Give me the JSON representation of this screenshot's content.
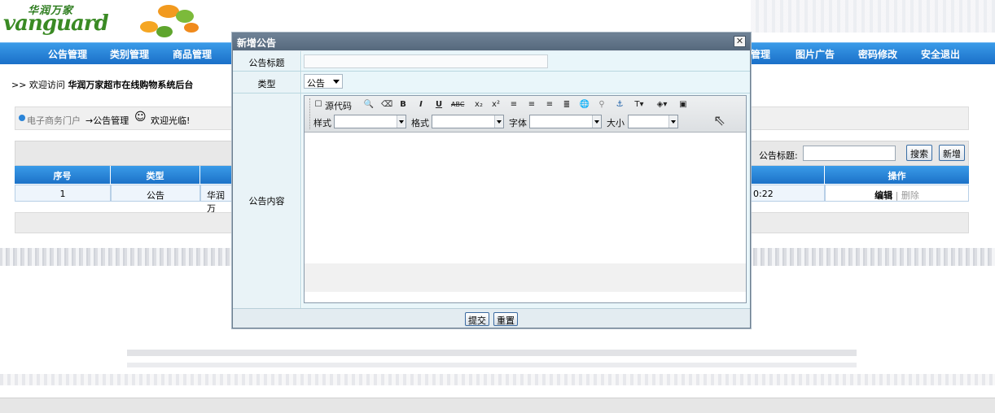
{
  "brand": {
    "cn": "华润万家",
    "en": "vanguard"
  },
  "nav": [
    "公告管理",
    "类别管理",
    "商品管理",
    "管理",
    "图片广告",
    "密码修改",
    "安全退出"
  ],
  "welcome": {
    "prefix": ">> 欢迎访问 ",
    "site": "华润万家超市在线购物系统后台"
  },
  "breadcrumb": {
    "portal": "电子商务门户",
    "current": "→公告管理",
    "greeting": "欢迎光临!"
  },
  "search": {
    "label": "公告标题:",
    "value": "",
    "search_button": "搜索",
    "add_button": "新增"
  },
  "table": {
    "headers": [
      "序号",
      "类型",
      "操作"
    ],
    "rows": [
      {
        "index": "1",
        "type": "公告",
        "title_fragment": "华润万",
        "time_fragment": "0:22",
        "edit": "编辑",
        "sep": "|",
        "delete": "删除"
      }
    ]
  },
  "modal": {
    "title": "新增公告",
    "close": "✕",
    "fields": {
      "title_label": "公告标题",
      "title_value": "",
      "type_label": "类型",
      "type_selected": "公告",
      "content_label": "公告内容"
    },
    "editor": {
      "source_label": "源代码",
      "style_label": "样式",
      "format_label": "格式",
      "font_label": "字体",
      "size_label": "大小"
    },
    "buttons": {
      "submit": "提交",
      "reset": "重置"
    }
  }
}
